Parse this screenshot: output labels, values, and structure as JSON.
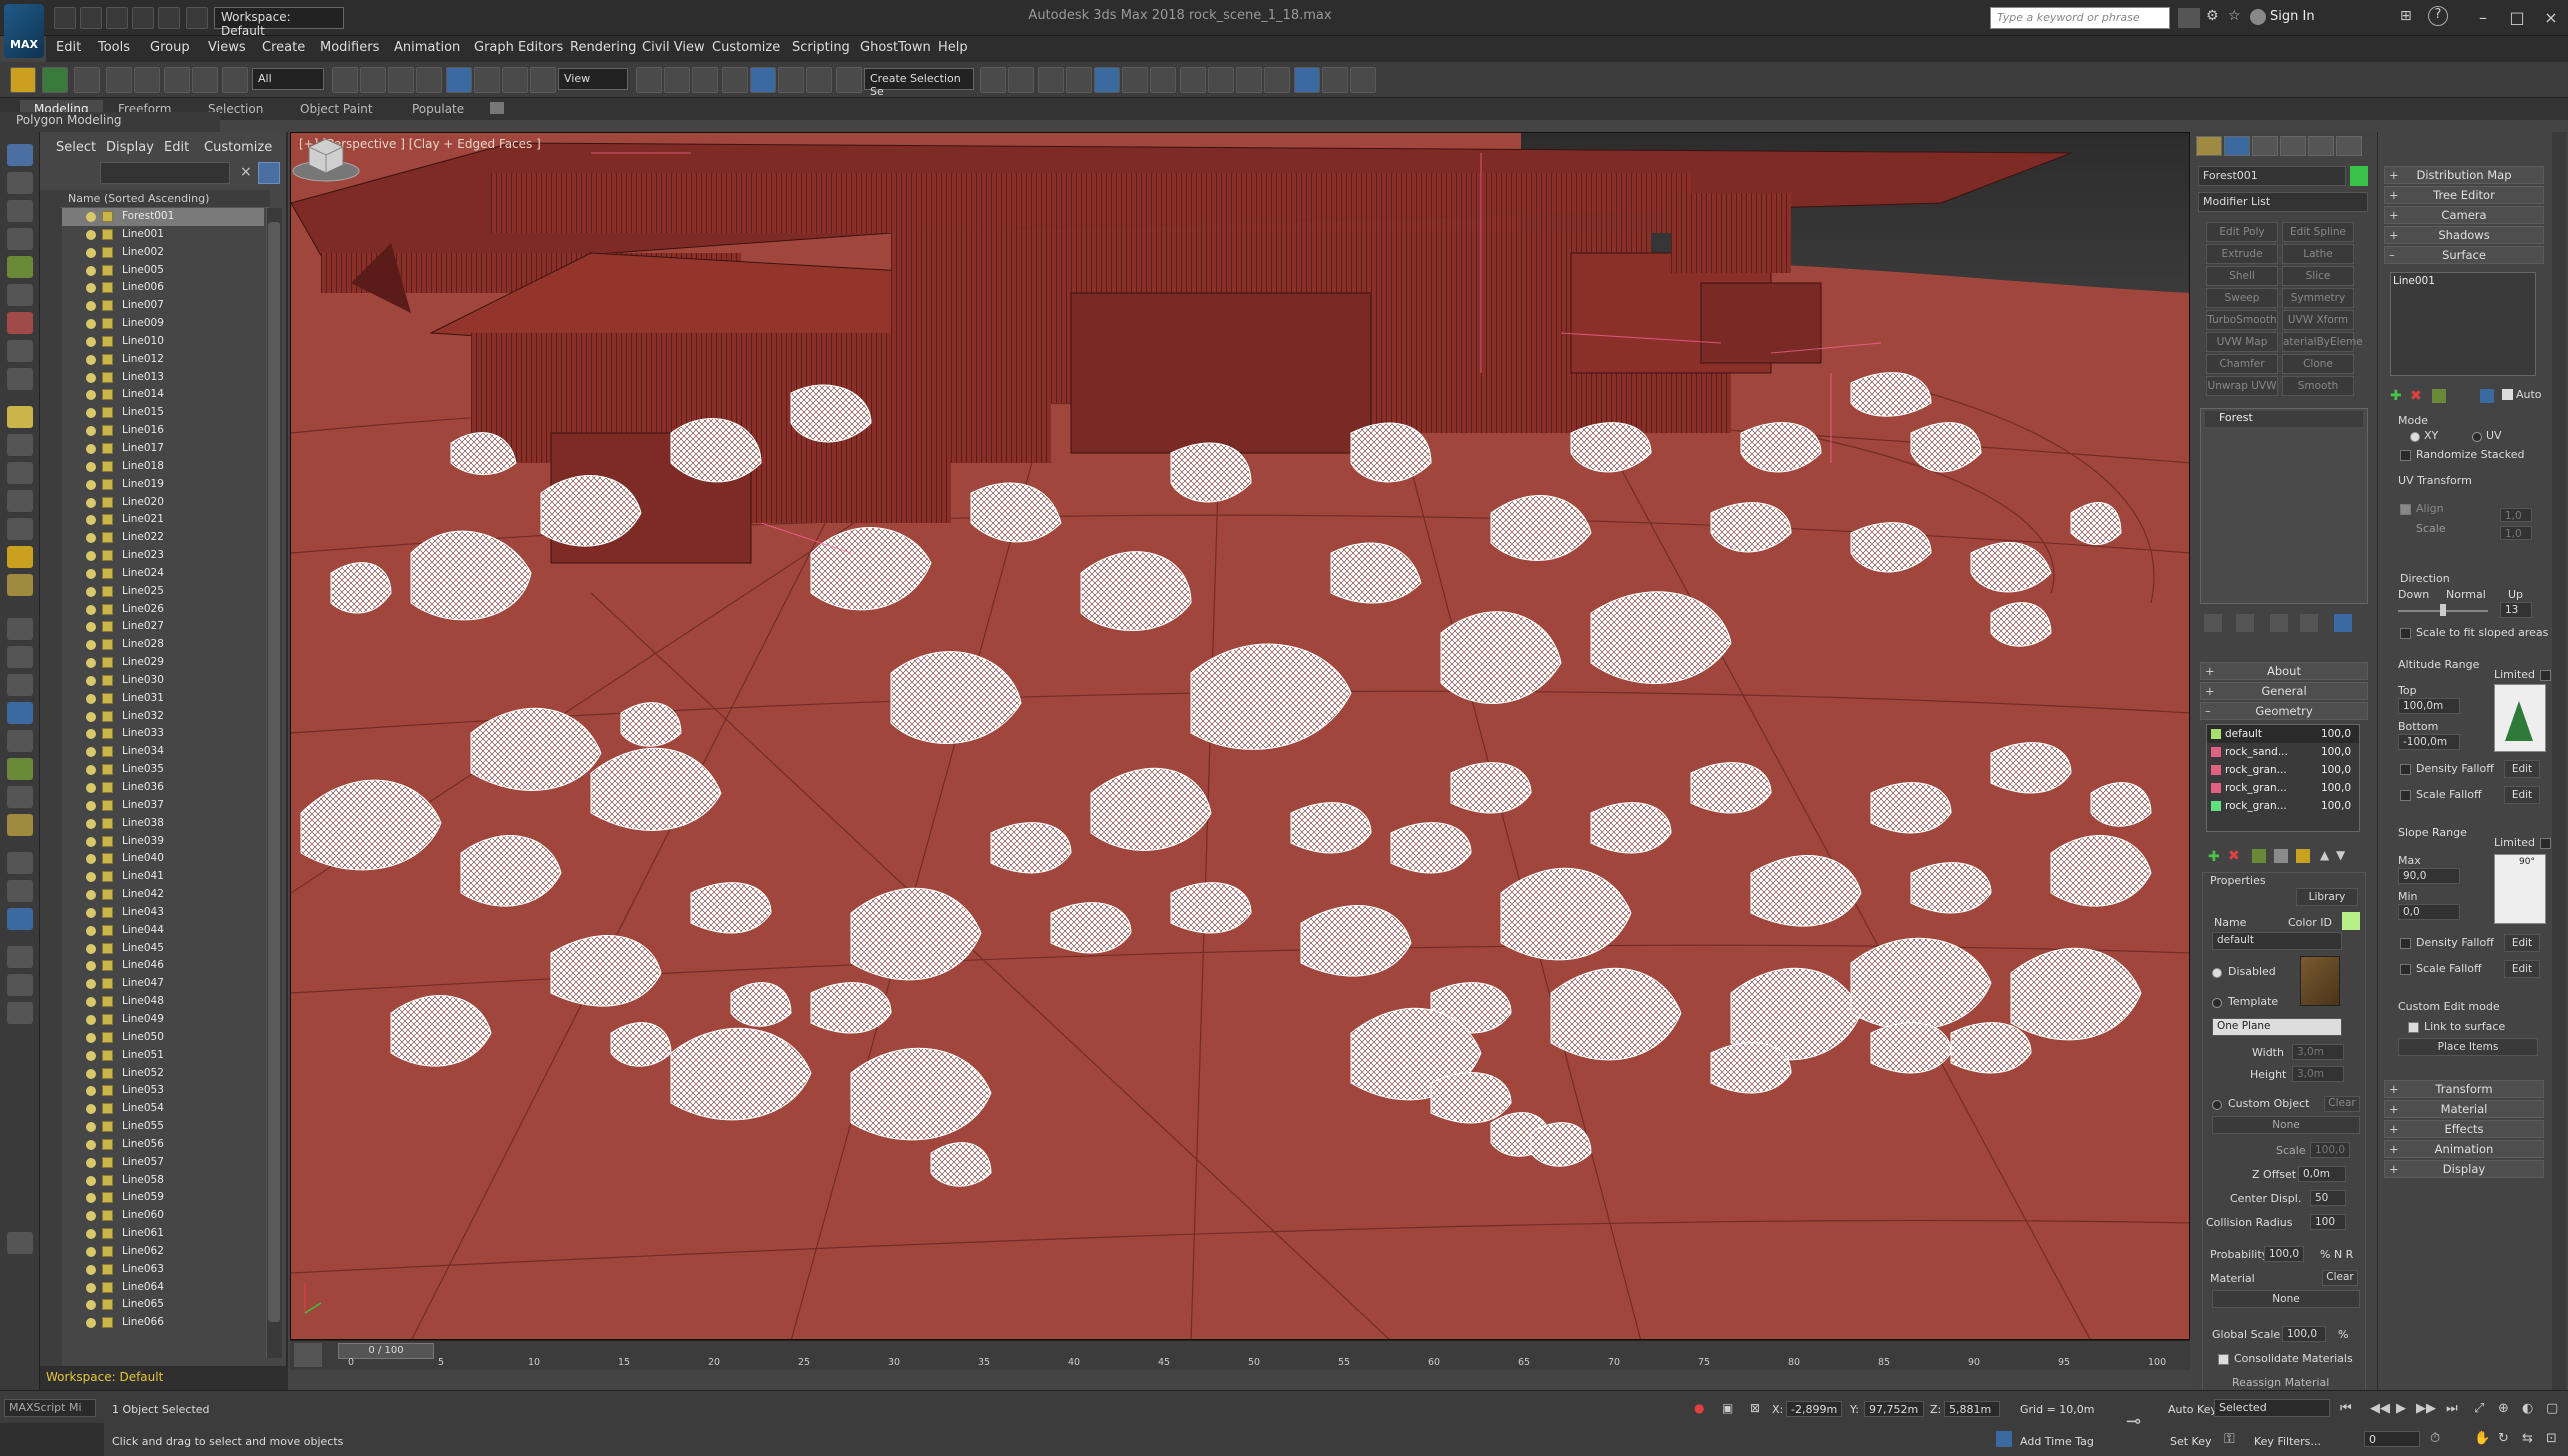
{
  "title_bar": {
    "logo": "MAX",
    "workspace": "Workspace: Default",
    "window_title": "Autodesk 3ds Max 2018  rock_scene_1_18.max",
    "search_placeholder": "Type a keyword or phrase",
    "sign_in": "Sign In"
  },
  "menu": [
    "Edit",
    "Tools",
    "Group",
    "Views",
    "Create",
    "Modifiers",
    "Animation",
    "Graph Editors",
    "Rendering",
    "Civil View",
    "Customize",
    "Scripting",
    "GhostTown",
    "Help"
  ],
  "toolbar": {
    "filter": "All",
    "ref_coord": "View",
    "selection_set": "Create Selection Se"
  },
  "ribbon": {
    "tabs": [
      "Modeling",
      "Freeform",
      "Selection",
      "Object Paint",
      "Populate"
    ],
    "active": "Modeling",
    "sub": "Polygon Modeling"
  },
  "explorer": {
    "menu": [
      "Select",
      "Display",
      "Edit",
      "Customize"
    ],
    "column_header": "Name (Sorted Ascending)",
    "items": [
      "Forest001",
      "Line001",
      "Line002",
      "Line005",
      "Line006",
      "Line007",
      "Line009",
      "Line010",
      "Line012",
      "Line013",
      "Line014",
      "Line015",
      "Line016",
      "Line017",
      "Line018",
      "Line019",
      "Line020",
      "Line021",
      "Line022",
      "Line023",
      "Line024",
      "Line025",
      "Line026",
      "Line027",
      "Line028",
      "Line029",
      "Line030",
      "Line031",
      "Line032",
      "Line033",
      "Line034",
      "Line035",
      "Line036",
      "Line037",
      "Line038",
      "Line039",
      "Line040",
      "Line041",
      "Line042",
      "Line043",
      "Line044",
      "Line045",
      "Line046",
      "Line047",
      "Line048",
      "Line049",
      "Line050",
      "Line051",
      "Line052",
      "Line053",
      "Line054",
      "Line055",
      "Line056",
      "Line057",
      "Line058",
      "Line059",
      "Line060",
      "Line061",
      "Line062",
      "Line063",
      "Line064",
      "Line065",
      "Line066"
    ],
    "footer": "Workspace: Default"
  },
  "viewport": {
    "label": "[+] [Perspective ] [Clay + Edged Faces ]"
  },
  "command_panel": {
    "object_name": "Forest001",
    "modifier_list": "Modifier List",
    "modifier_buttons": [
      "Edit Poly",
      "Edit Spline",
      "Extrude",
      "Lathe",
      "Shell",
      "Slice",
      "Sweep",
      "Symmetry",
      "TurboSmooth",
      "UVW Xform",
      "UVW Map",
      "aterialByEleme",
      "Chamfer",
      "Clone",
      "Unwrap UVW",
      "Smooth"
    ],
    "stack": [
      "Forest"
    ],
    "rollouts": [
      "About",
      "General",
      "Geometry"
    ],
    "geometry_list": [
      {
        "name": "default",
        "value": "100,0",
        "color": "#a8e070"
      },
      {
        "name": "rock_sand...",
        "value": "100,0",
        "color": "#e06080"
      },
      {
        "name": "rock_gran...",
        "value": "100,0",
        "color": "#e06080"
      },
      {
        "name": "rock_gran...",
        "value": "100,0",
        "color": "#e06080"
      },
      {
        "name": "rock_gran...",
        "value": "100,0",
        "color": "#60e080"
      }
    ],
    "properties": {
      "title": "Properties",
      "library": "Library",
      "name_label": "Name",
      "color_id": "Color ID",
      "name_value": "default",
      "disabled": "Disabled",
      "template": "Template",
      "one_plane": "One Plane",
      "width_label": "Width",
      "width": "3,0m",
      "height_label": "Height",
      "height": "3,0m",
      "custom_object": "Custom Object",
      "clear": "Clear",
      "none": "None",
      "scale_label": "Scale",
      "scale": "100,0",
      "z_offset_label": "Z Offset",
      "z_offset": "0,0m",
      "center_displ_label": "Center Displ.",
      "center_displ": "50",
      "collision_radius_label": "Collision Radius",
      "collision_radius": "100",
      "probability_label": "Probability",
      "probability": "100,0",
      "pct_n_r": "% N R",
      "material_label": "Material",
      "global_scale_label": "Global Scale",
      "global_scale": "100,0",
      "consolidate": "Consolidate Materials",
      "reassign": "Reassign Material"
    }
  },
  "panel2": {
    "rollouts_top": [
      "Distribution Map",
      "Tree Editor",
      "Camera",
      "Shadows",
      "Surface"
    ],
    "surface_list": [
      "Line001"
    ],
    "auto": "Auto",
    "mode": "Mode",
    "xy": "XY",
    "uv": "UV",
    "randomize_stacked": "Randomize Stacked",
    "uv_transform": "UV Transform",
    "align": "Align",
    "scale": "Scale",
    "u_val": "1,0",
    "v_val": "1,0",
    "direction": "Direction",
    "down": "Down",
    "normal": "Normal",
    "up": "Up",
    "dir_value": "13",
    "scale_fit": "Scale to fit sloped areas",
    "altitude_range": "Altitude Range",
    "limited": "Limited",
    "top": "Top",
    "top_val": "100,0m",
    "bottom": "Bottom",
    "bottom_val": "-100,0m",
    "density_falloff": "Density Falloff",
    "scale_falloff": "Scale Falloff",
    "edit": "Edit",
    "slope_range": "Slope Range",
    "max": "Max",
    "max_val": "90,0",
    "min": "Min",
    "min_val": "0,0",
    "slope_badge": "90°",
    "custom_edit_mode": "Custom Edit mode",
    "link_to_surface": "Link to surface",
    "place_items": "Place Items",
    "rollouts_bottom": [
      "Transform",
      "Material",
      "Effects",
      "Animation",
      "Display"
    ]
  },
  "timeline": {
    "slider": "0 / 100",
    "ticks": [
      "0",
      "5",
      "10",
      "15",
      "20",
      "25",
      "30",
      "35",
      "40",
      "45",
      "50",
      "55",
      "60",
      "65",
      "70",
      "75",
      "80",
      "85",
      "90",
      "95",
      "100"
    ]
  },
  "status": {
    "maxscript": "MAXScript Mi",
    "selected": "1 Object Selected",
    "prompt": "Click and drag to select and move objects",
    "x_label": "X:",
    "x": "-2,899m",
    "y_label": "Y:",
    "y": "97,752m",
    "z_label": "Z:",
    "z": "5,881m",
    "grid": "Grid = 10,0m",
    "add_time_tag": "Add Time Tag",
    "auto_key": "Auto Key",
    "set_key": "Set Key",
    "selected_dd": "Selected",
    "key_filters": "Key Filters...",
    "frame": "0"
  }
}
